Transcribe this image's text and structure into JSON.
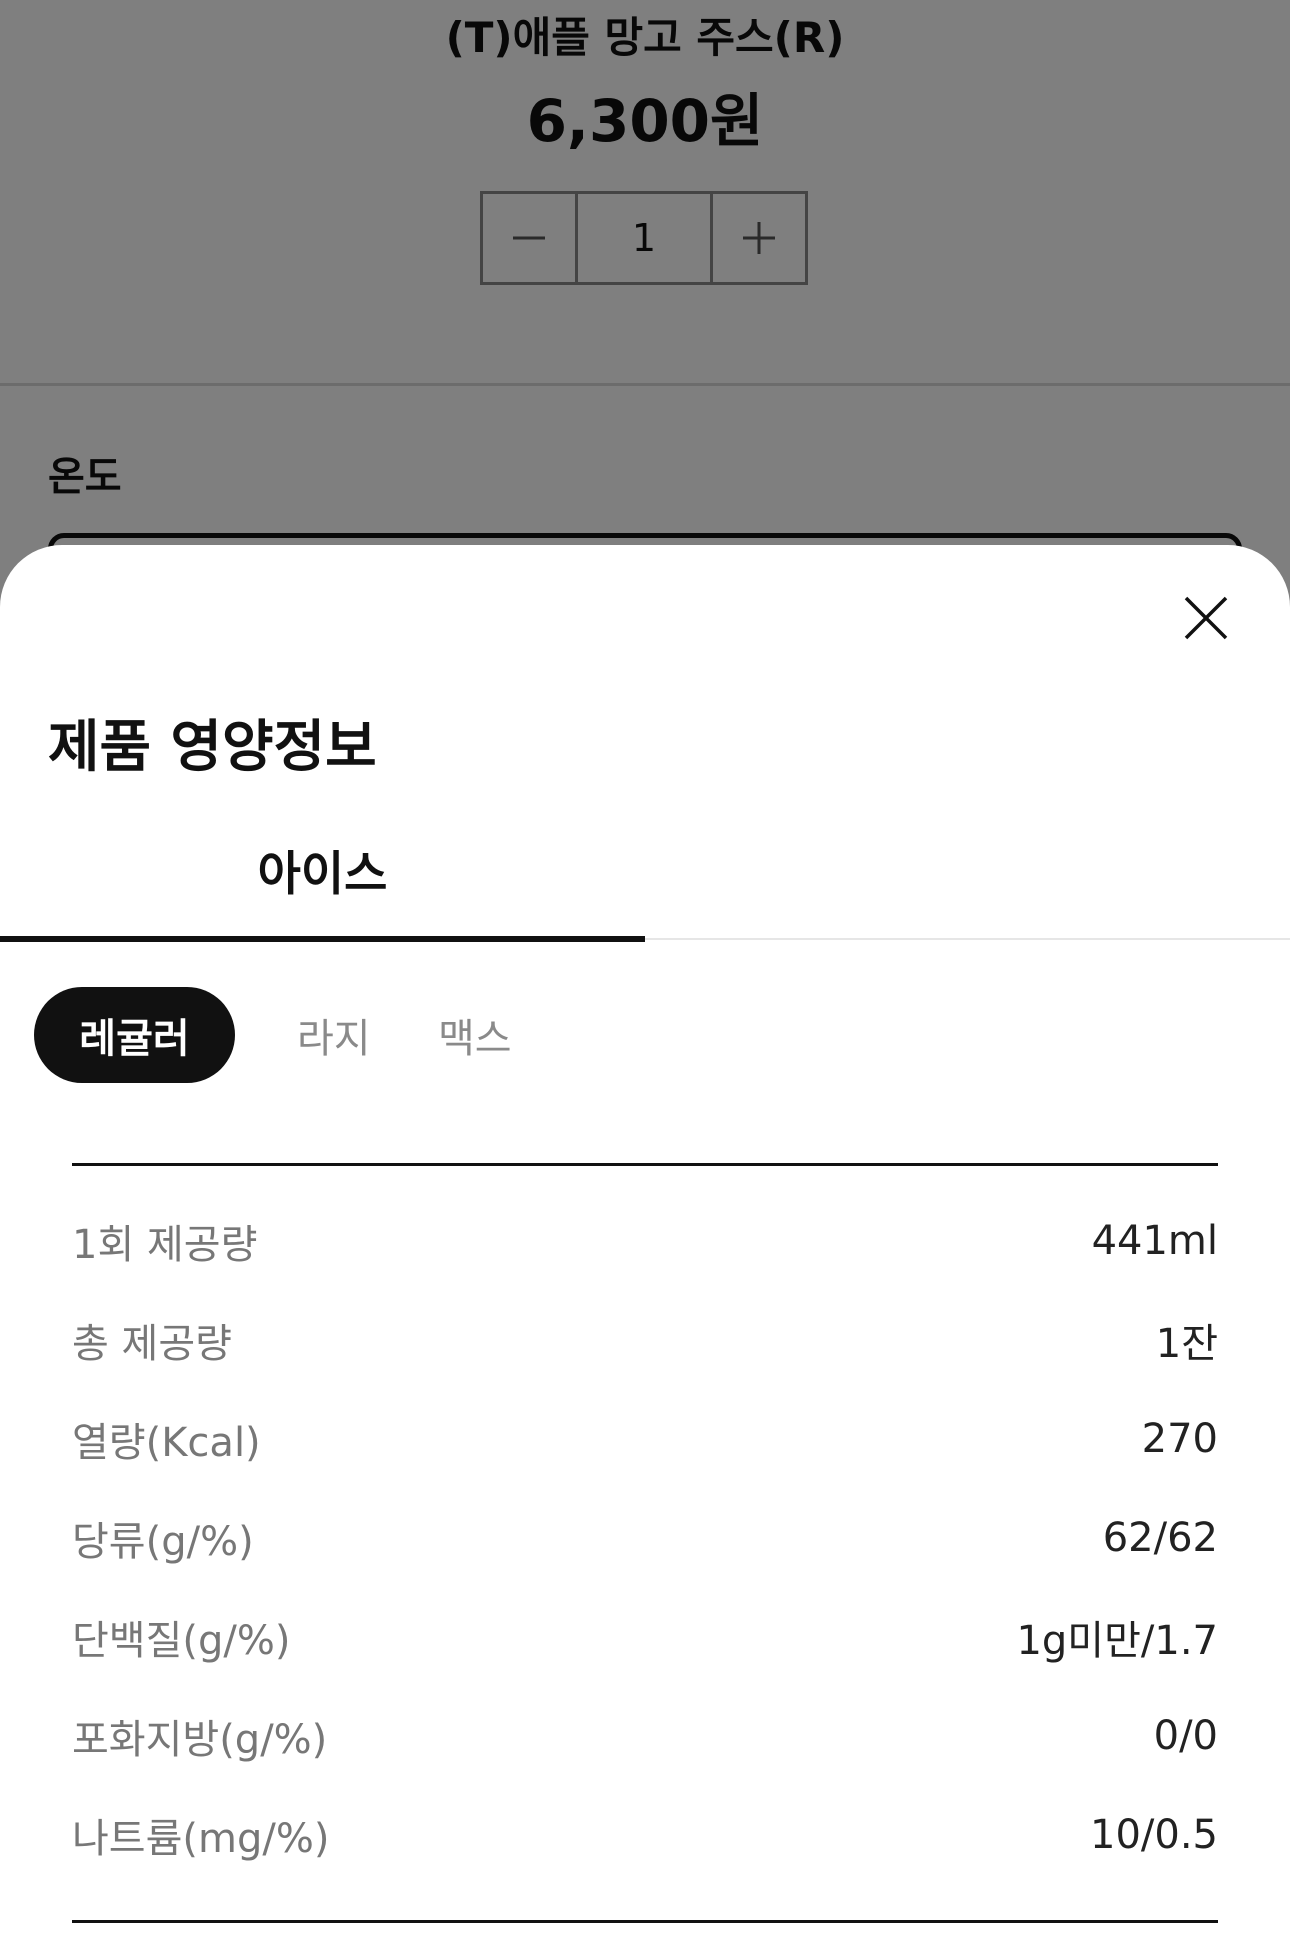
{
  "product": {
    "name": "(T)애플 망고 주스(R)",
    "price": "6,300원",
    "quantity": "1"
  },
  "options": {
    "temperature_label": "온도"
  },
  "sheet": {
    "title": "제품 영양정보",
    "tabs": [
      {
        "label": "아이스",
        "active": true
      }
    ],
    "sizes": [
      {
        "label": "레귤러",
        "active": true
      },
      {
        "label": "라지",
        "active": false
      },
      {
        "label": "맥스",
        "active": false
      }
    ],
    "nutrition": [
      {
        "label": "1회 제공량",
        "value": "441ml"
      },
      {
        "label": "총 제공량",
        "value": "1잔"
      },
      {
        "label": "열량(Kcal)",
        "value": "270"
      },
      {
        "label": "당류(g/%)",
        "value": "62/62"
      },
      {
        "label": "단백질(g/%)",
        "value": "1g미만/1.7"
      },
      {
        "label": "포화지방(g/%)",
        "value": "0/0"
      },
      {
        "label": "나트륨(mg/%)",
        "value": "10/0.5"
      }
    ]
  },
  "icons": {
    "minus": "minus-icon",
    "plus": "plus-icon",
    "close": "close-icon"
  }
}
